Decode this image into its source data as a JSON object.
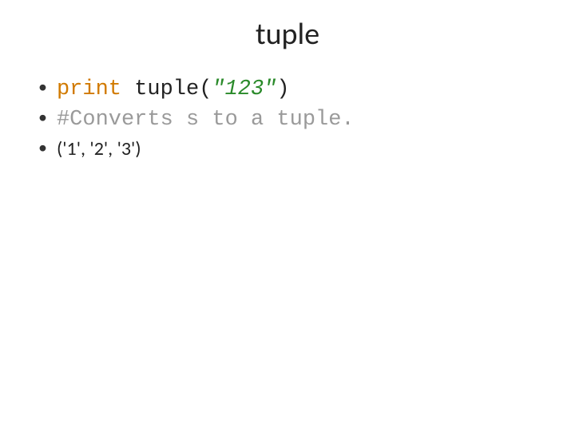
{
  "title": "tuple",
  "bullets": {
    "line1": {
      "kw": "print",
      "sp": " ",
      "fn": "tuple",
      "open": "(",
      "str": "\"123\"",
      "close": ")"
    },
    "line2": "#Converts s to a tuple.",
    "line3": "('1', '2', '3')"
  }
}
